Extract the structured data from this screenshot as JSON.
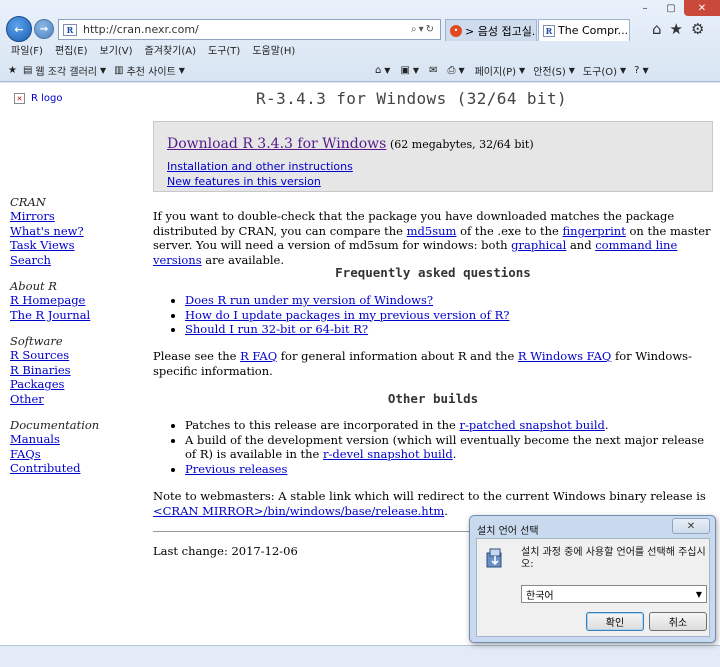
{
  "browser": {
    "url": "http://cran.nexr.com/",
    "tabs": [
      {
        "label": "> 음성 접고실..."
      },
      {
        "label": "The Compr...",
        "active": true
      }
    ],
    "window_controls": [
      "–",
      "▢",
      "✕"
    ],
    "menu": [
      "파일(F)",
      "편집(E)",
      "보기(V)",
      "즐겨찾기(A)",
      "도구(T)",
      "도움말(H)"
    ],
    "toolbar": {
      "web_slice": "웹 조각 갤러리",
      "suggested": "추천 사이트",
      "page": "페이지(P)",
      "safety": "안전(S)",
      "tools": "도구(O)"
    }
  },
  "page": {
    "logo_alt": "R logo",
    "title": "R-3.4.3 for Windows (32/64 bit)",
    "download": {
      "link": "Download R 3.4.3 for Windows",
      "size": "(62 megabytes, 32/64 bit)",
      "install": "Installation and other instructions",
      "features": "New features in this version"
    },
    "md5": {
      "p1": "If you want to double-check that the package you have downloaded matches the package distributed by CRAN, you can compare the ",
      "md5sum": "md5sum",
      "p2": " of the .exe to the ",
      "fingerprint": "fingerprint",
      "p3": " on the master server. You will need a version of md5sum for windows: both ",
      "graphical": "graphical",
      "p4": " and ",
      "cmdline": "command line versions",
      "p5": " are available."
    },
    "faq_title": "Frequently asked questions",
    "faq_items": [
      "Does R run under my version of Windows?",
      "How do I update packages in my previous version of R?",
      "Should I run 32-bit or 64-bit R?"
    ],
    "faq_note": {
      "p1": "Please see the ",
      "rfaq": "R FAQ",
      "p2": " for general information about R and the ",
      "wfaq": "R Windows FAQ",
      "p3": " for Windows-specific information."
    },
    "other_title": "Other builds",
    "other": {
      "i1a": "Patches to this release are incorporated in the ",
      "i1link": "r-patched snapshot build",
      "i1b": ".",
      "i2a": "A build of the development version (which will eventually become the next major release of R) is available in the ",
      "i2link": "r-devel snapshot build",
      "i2b": ".",
      "i3": "Previous releases"
    },
    "webmaster": {
      "p1": "Note to webmasters: A stable link which will redirect to the current Windows binary release is ",
      "link": "<CRAN MIRROR>/bin/windows/base/release.htm",
      "p2": "."
    },
    "last_change": "Last change: 2017-12-06"
  },
  "sidebar": [
    {
      "heading": "CRAN",
      "links": [
        "Mirrors",
        "What's new?",
        "Task Views",
        "Search"
      ]
    },
    {
      "heading": "About R",
      "links": [
        "R Homepage",
        "The R Journal"
      ]
    },
    {
      "heading": "Software",
      "links": [
        "R Sources",
        "R Binaries",
        "Packages",
        "Other"
      ]
    },
    {
      "heading": "Documentation",
      "links": [
        "Manuals",
        "FAQs",
        "Contributed"
      ]
    }
  ],
  "dialog": {
    "title": "설치 언어 선택",
    "message": "설치 과정 중에 사용할 언어를 선택해 주십시오:",
    "selected_language": "한국어",
    "ok": "확인",
    "cancel": "취소"
  }
}
